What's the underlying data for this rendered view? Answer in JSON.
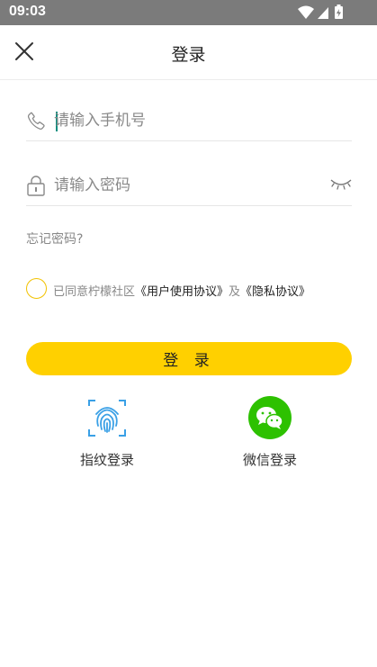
{
  "status_bar": {
    "time": "09:03"
  },
  "header": {
    "title": "登录"
  },
  "form": {
    "phone_placeholder": "请输入手机号",
    "password_placeholder": "请输入密码",
    "forgot_password": "忘记密码?",
    "agreement": {
      "prefix": "已同意柠檬社区",
      "user_agreement": "《用户使用协议》",
      "conjunction": "及",
      "privacy_agreement": "《隐私协议》",
      "checked": false
    },
    "login_button": "登 录"
  },
  "alt_login": [
    {
      "label": "指纹登录",
      "icon": "fingerprint-icon"
    },
    {
      "label": "微信登录",
      "icon": "wechat-icon"
    }
  ],
  "colors": {
    "accent": "#ffd000",
    "status_bar": "#7b7b7b",
    "wechat": "#2dc100",
    "fingerprint": "#3aa0e6",
    "cursor": "#0e8f80"
  }
}
